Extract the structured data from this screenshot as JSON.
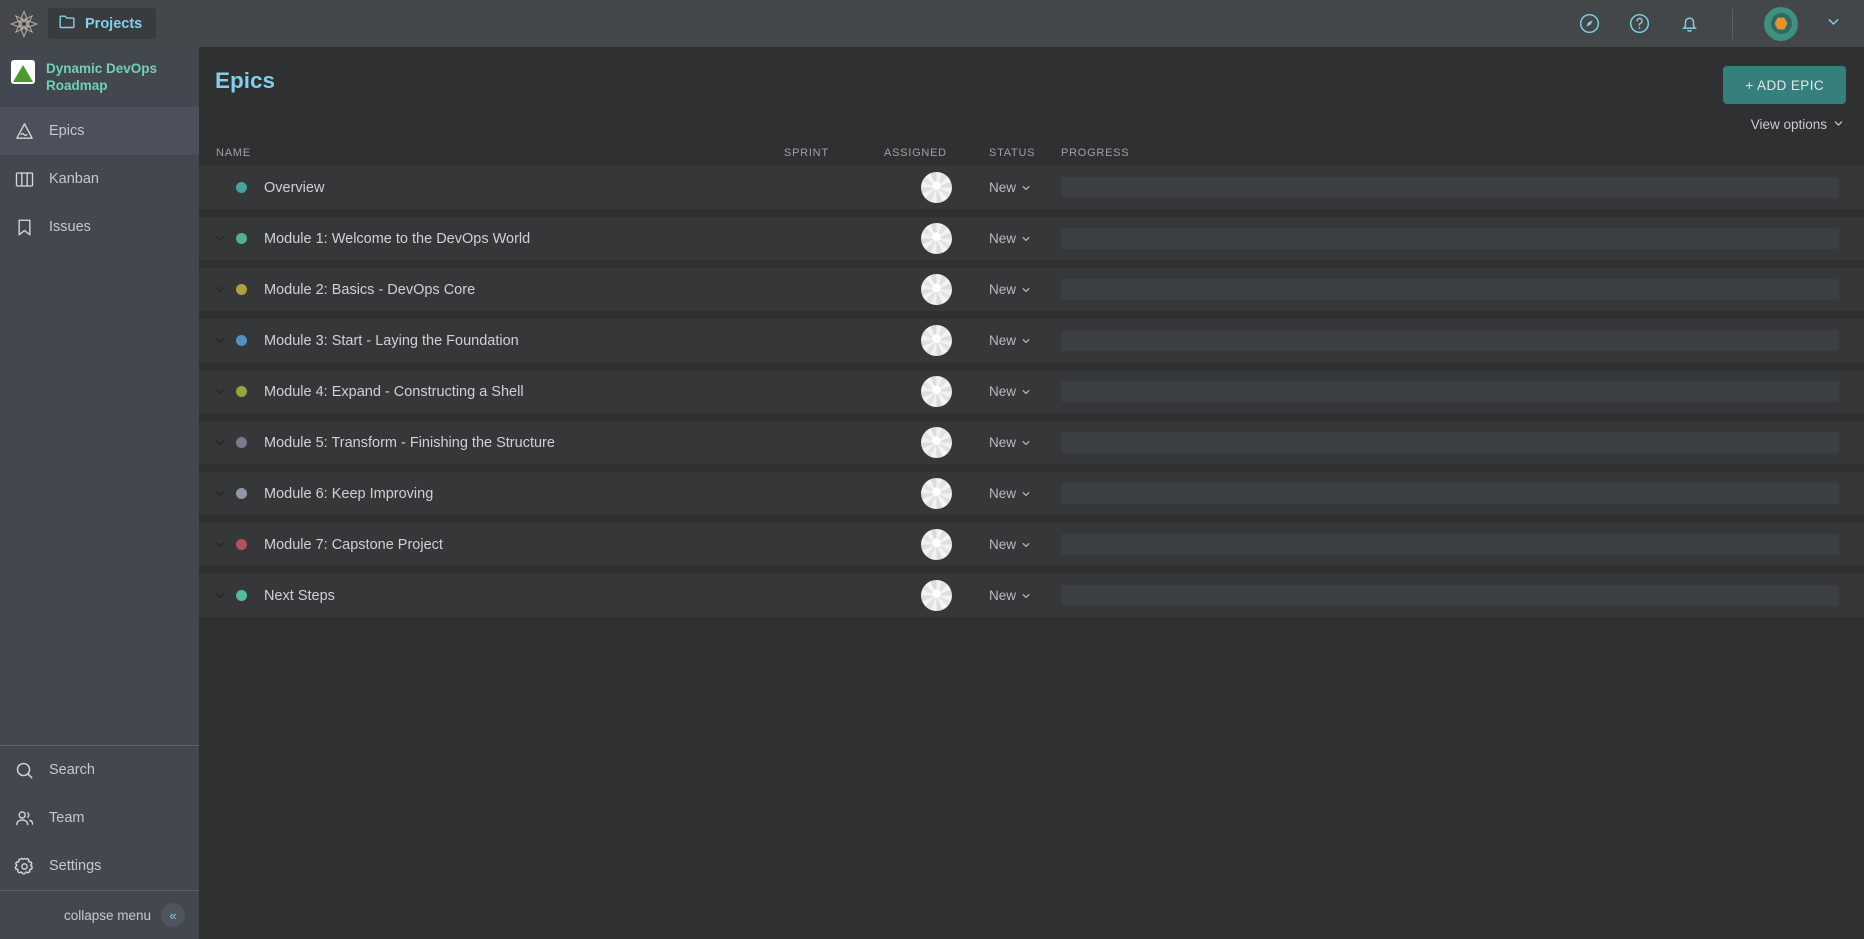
{
  "topbar": {
    "logo_icon": "star-mandala-logo",
    "projects_label": "Projects",
    "projects_icon": "folder-icon",
    "explore_icon": "compass-icon",
    "help_icon": "question-circle-icon",
    "notifications_icon": "bell-icon",
    "avatar_icon": "user-avatar-hexagon",
    "user_chevron_icon": "chevron-down-icon",
    "accent_blue": "#7fd0ea",
    "bar_bg": "#43474a"
  },
  "sidebar": {
    "project_title": "Dynamic DevOps Roadmap",
    "project_icon": "green-pyramid-icon",
    "project_title_color": "#6fd2b6",
    "bg": "#434750",
    "items": [
      {
        "label": "Epics",
        "icon": "mountain-icon",
        "active": true
      },
      {
        "label": "Kanban",
        "icon": "columns-icon",
        "active": false
      },
      {
        "label": "Issues",
        "icon": "bookmark-icon",
        "active": false
      }
    ],
    "bottom_items": [
      {
        "label": "Search",
        "icon": "search-icon"
      },
      {
        "label": "Team",
        "icon": "people-icon"
      },
      {
        "label": "Settings",
        "icon": "gear-icon"
      }
    ],
    "collapse_label": "collapse menu",
    "collapse_icon": "double-chevron-left-icon"
  },
  "main": {
    "page_title": "Epics",
    "add_epic_label": "+ ADD EPIC",
    "add_epic_color": "#35807c",
    "view_options_label": "View options",
    "view_options_icon": "chevron-down-icon",
    "columns": [
      "NAME",
      "SPRINT",
      "ASSIGNED",
      "STATUS",
      "PROGRESS"
    ],
    "rows": [
      {
        "name": "Overview",
        "dot": "#45a39b",
        "expandable": false,
        "twisty_icon": "",
        "sprint": "",
        "assigned_icon": "avatar-placeholder",
        "status": "New",
        "status_icon": "chevron-down-icon",
        "progress": 0
      },
      {
        "name": "Module 1: Welcome to the DevOps World",
        "dot": "#52b08a",
        "expandable": true,
        "twisty_icon": "chevron-down-icon",
        "sprint": "",
        "assigned_icon": "avatar-placeholder",
        "status": "New",
        "status_icon": "chevron-down-icon",
        "progress": 0
      },
      {
        "name": "Module 2: Basics - DevOps Core",
        "dot": "#b0a03d",
        "expandable": true,
        "twisty_icon": "chevron-down-icon",
        "sprint": "",
        "assigned_icon": "avatar-placeholder",
        "status": "New",
        "status_icon": "chevron-down-icon",
        "progress": 0
      },
      {
        "name": "Module 3: Start - Laying the Foundation",
        "dot": "#5590bd",
        "expandable": true,
        "twisty_icon": "chevron-down-icon",
        "sprint": "",
        "assigned_icon": "avatar-placeholder",
        "status": "New",
        "status_icon": "chevron-down-icon",
        "progress": 0
      },
      {
        "name": "Module 4: Expand - Constructing a Shell",
        "dot": "#96a53d",
        "expandable": true,
        "twisty_icon": "chevron-down-icon",
        "sprint": "",
        "assigned_icon": "avatar-placeholder",
        "status": "New",
        "status_icon": "chevron-down-icon",
        "progress": 0
      },
      {
        "name": "Module 5: Transform - Finishing the Structure",
        "dot": "#7a7a8c",
        "expandable": true,
        "twisty_icon": "chevron-down-icon",
        "sprint": "",
        "assigned_icon": "avatar-placeholder",
        "status": "New",
        "status_icon": "chevron-down-icon",
        "progress": 0
      },
      {
        "name": "Module 6: Keep Improving",
        "dot": "#9295a8",
        "expandable": true,
        "twisty_icon": "chevron-down-icon",
        "sprint": "",
        "assigned_icon": "avatar-placeholder",
        "status": "New",
        "status_icon": "chevron-down-icon",
        "progress": 0
      },
      {
        "name": "Module 7: Capstone Project",
        "dot": "#b1535f",
        "expandable": true,
        "twisty_icon": "chevron-down-icon",
        "sprint": "",
        "assigned_icon": "avatar-placeholder",
        "status": "New",
        "status_icon": "chevron-down-icon",
        "progress": 0
      },
      {
        "name": "Next Steps",
        "dot": "#53bba2",
        "expandable": true,
        "twisty_icon": "chevron-down-icon",
        "sprint": "",
        "assigned_icon": "avatar-placeholder",
        "status": "New",
        "status_icon": "chevron-down-icon",
        "progress": 0
      }
    ]
  }
}
